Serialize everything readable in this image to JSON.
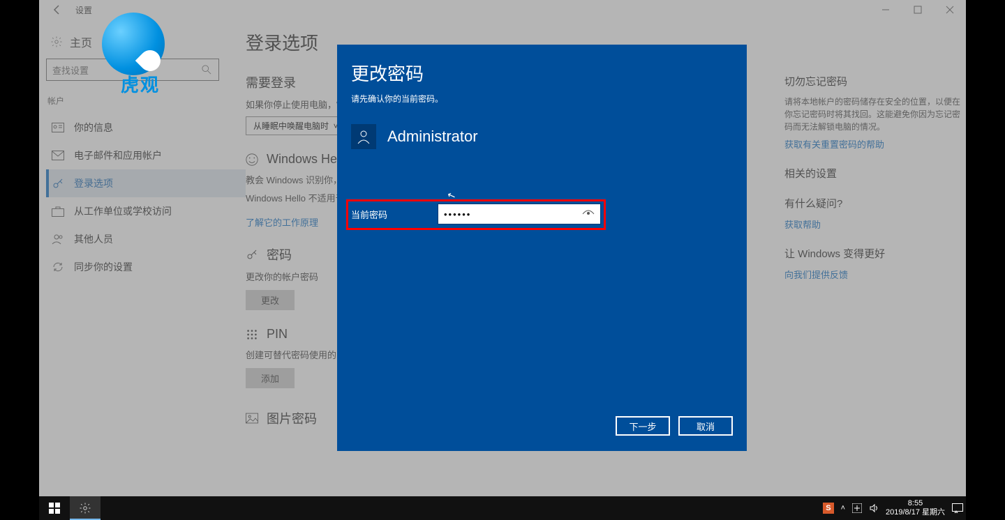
{
  "window": {
    "title": "设置",
    "home_label": "主页",
    "search_placeholder": "查找设置"
  },
  "sidebar": {
    "category": "帐户",
    "items": [
      {
        "label": "你的信息"
      },
      {
        "label": "电子邮件和应用帐户"
      },
      {
        "label": "登录选项"
      },
      {
        "label": "从工作单位或学校访问"
      },
      {
        "label": "其他人员"
      },
      {
        "label": "同步你的设置"
      }
    ]
  },
  "main": {
    "title": "登录选项",
    "req_login": {
      "h": "需要登录",
      "p": "如果你停止使用电脑，Windows 何时要求你重新登录？",
      "sel": "从睡眠中唤醒电脑时"
    },
    "hello": {
      "h": "Windows Hello",
      "p1": "教会 Windows 识别你，以便登录到 Windows、应用和服务。",
      "link": "了解它的工作原理",
      "p2": "Windows Hello 不适用于此设备。"
    },
    "password": {
      "h": "密码",
      "p": "更改你的帐户密码",
      "btn": "更改"
    },
    "pin": {
      "h": "PIN",
      "p1": "创建可替代密码使用的 PIN。当你登录 Windows 及其应用和服务时，系统会要求你输入此 PIN。",
      "btn": "添加"
    },
    "picpwd": {
      "h": "图片密码"
    }
  },
  "right": {
    "s1_h": "切勿忘记密码",
    "s1_p": "请将本地帐户的密码储存在安全的位置，以便在你忘记密码时将其找回。这能避免你因为忘记密码而无法解锁电脑的情况。",
    "s1_link": "获取有关重置密码的帮助",
    "s2_h": "相关的设置",
    "s3_h": "有什么疑问?",
    "s3_link": "获取帮助",
    "s4_h": "让 Windows 变得更好",
    "s4_link": "向我们提供反馈"
  },
  "modal": {
    "title": "更改密码",
    "sub": "请先确认你的当前密码。",
    "user": "Administrator",
    "field_label": "当前密码",
    "password_masked": "••••••",
    "next": "下一步",
    "cancel": "取消"
  },
  "taskbar": {
    "time": "8:55",
    "date": "2019/8/17 星期六"
  },
  "watermark": "虎观"
}
